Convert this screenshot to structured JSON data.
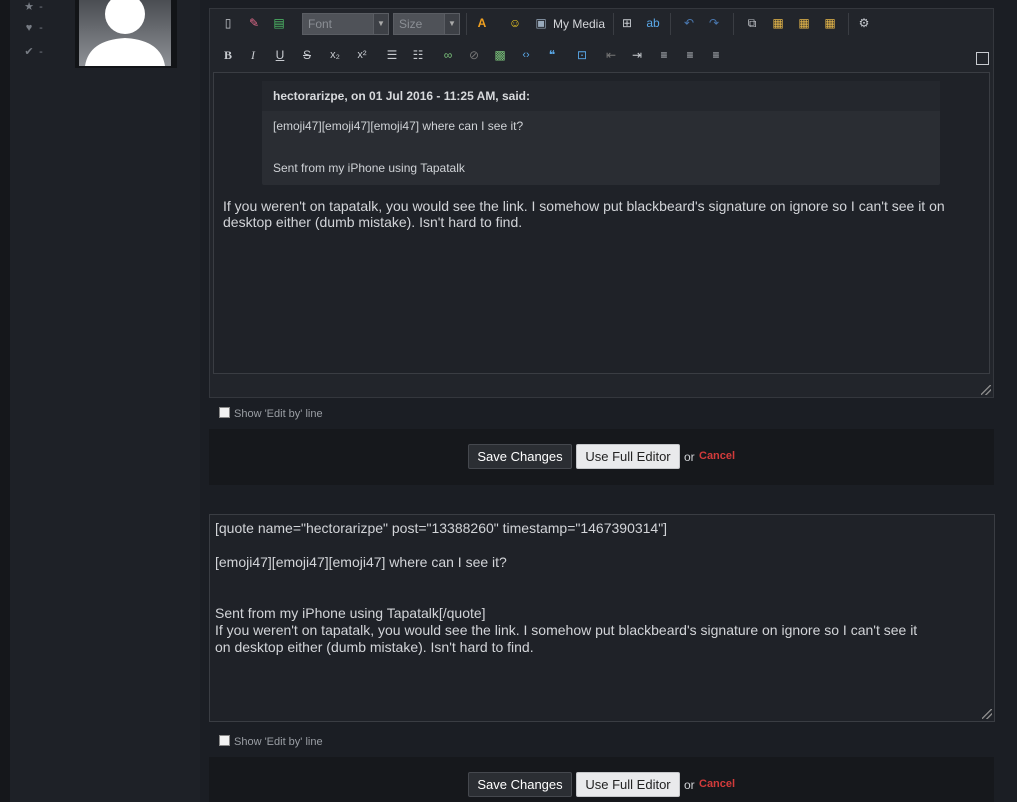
{
  "profile": {
    "stats": [
      {
        "icon": "star-icon",
        "glyph": "★",
        "value": "-"
      },
      {
        "icon": "heart-icon",
        "glyph": "♥",
        "value": "-"
      },
      {
        "icon": "check-icon",
        "glyph": "✔",
        "value": "-"
      }
    ]
  },
  "toolbar": {
    "font_placeholder": "Font",
    "size_placeholder": "Size",
    "my_media_label": "My Media"
  },
  "editor": {
    "quote_header": "hectorarizpe, on 01 Jul 2016 - 11:25 AM, said:",
    "quote_line1": "[emoji47][emoji47][emoji47] where can I see it?",
    "quote_line2": "Sent from my iPhone using Tapatalk",
    "reply": "If you weren't on tapatalk, you would see the link. I somehow put blackbeard's signature on ignore so I can't see it on desktop either (dumb mistake). Isn't hard to find."
  },
  "edit_by_label": "Show 'Edit by' line",
  "actions": {
    "save_label": "Save Changes",
    "full_editor_label": "Use Full Editor",
    "or_text": "or",
    "cancel_label": "Cancel"
  },
  "raw_editor": {
    "line1": "[quote name=\"hectorarizpe\" post=\"13388260\" timestamp=\"1467390314\"]",
    "line2": "[emoji47][emoji47][emoji47] where can I see it?",
    "line3": "Sent from my iPhone using Tapatalk[/quote]",
    "line4": "If you weren't on tapatalk, you would see the link. I somehow put blackbeard's signature on ignore so I can't see it",
    "line5": "on desktop either (dumb mistake). Isn't hard to find."
  },
  "colors": {
    "background": "#1b1e24",
    "cancel": "#d23b3b"
  }
}
